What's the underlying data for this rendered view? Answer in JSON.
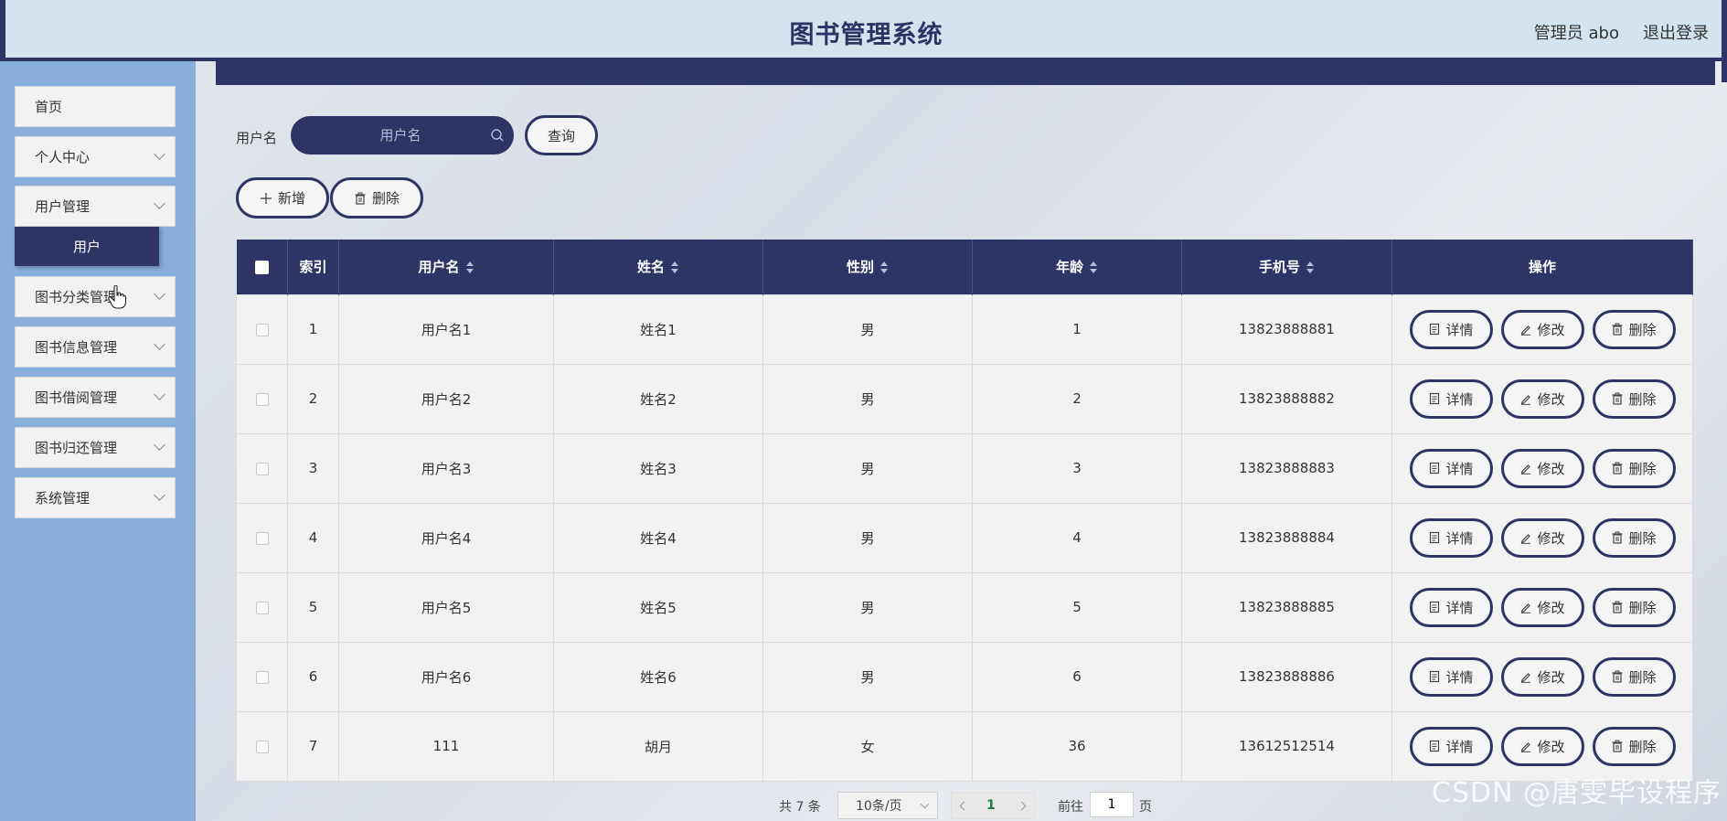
{
  "header": {
    "title": "图书管理系统",
    "user": "管理员 abo",
    "logout": "退出登录"
  },
  "sidebar": {
    "items": [
      {
        "label": "首页"
      },
      {
        "label": "个人中心"
      },
      {
        "label": "用户管理"
      },
      {
        "label": "图书分类管理"
      },
      {
        "label": "图书信息管理"
      },
      {
        "label": "图书借阅管理"
      },
      {
        "label": "图书归还管理"
      },
      {
        "label": "系统管理"
      }
    ],
    "submenu_active": "用户"
  },
  "search": {
    "label": "用户名",
    "placeholder": "用户名",
    "button": "查询"
  },
  "actions": {
    "add": "新增",
    "delete": "删除"
  },
  "table": {
    "headers": [
      "索引",
      "用户名",
      "姓名",
      "性别",
      "年龄",
      "手机号",
      "操作"
    ],
    "rows": [
      {
        "index": "1",
        "username": "用户名1",
        "name": "姓名1",
        "gender": "男",
        "age": "1",
        "phone": "13823888881"
      },
      {
        "index": "2",
        "username": "用户名2",
        "name": "姓名2",
        "gender": "男",
        "age": "2",
        "phone": "13823888882"
      },
      {
        "index": "3",
        "username": "用户名3",
        "name": "姓名3",
        "gender": "男",
        "age": "3",
        "phone": "13823888883"
      },
      {
        "index": "4",
        "username": "用户名4",
        "name": "姓名4",
        "gender": "男",
        "age": "4",
        "phone": "13823888884"
      },
      {
        "index": "5",
        "username": "用户名5",
        "name": "姓名5",
        "gender": "男",
        "age": "5",
        "phone": "13823888885"
      },
      {
        "index": "6",
        "username": "用户名6",
        "name": "姓名6",
        "gender": "男",
        "age": "6",
        "phone": "13823888886"
      },
      {
        "index": "7",
        "username": "111",
        "name": "胡月",
        "gender": "女",
        "age": "36",
        "phone": "13612512514"
      }
    ],
    "ops": {
      "detail": "详情",
      "edit": "修改",
      "delete": "删除"
    }
  },
  "pagination": {
    "total": "共 7 条",
    "page_size": "10条/页",
    "current": "1",
    "goto_label": "前往",
    "goto_value": "1",
    "page_suffix": "页"
  },
  "watermark": "CSDN @唐雯毕设程序",
  "colors": {
    "primary": "#2e3466",
    "sidebar": "#88aedc",
    "header": "#d3e4ef"
  }
}
